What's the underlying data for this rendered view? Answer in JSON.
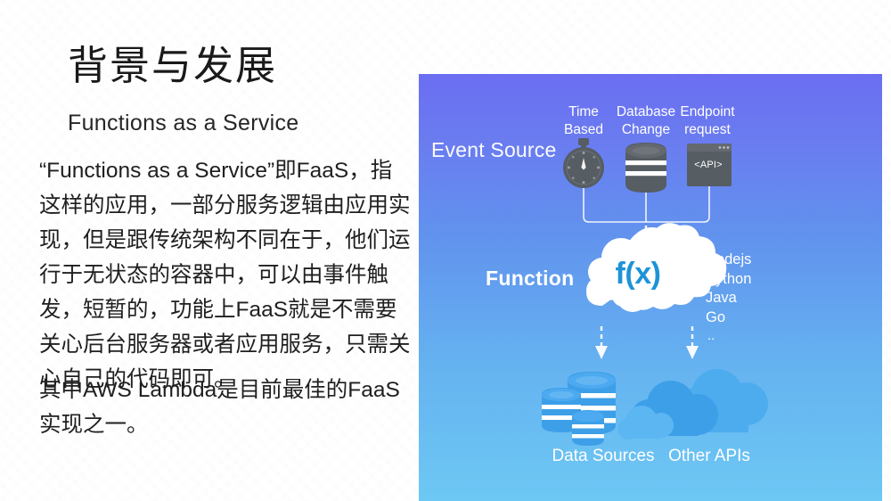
{
  "slide": {
    "title": "背景与发展",
    "subtitle": "Functions as a Service",
    "paragraph_1": "   “Functions as a Service”即FaaS，指这样的应用，一部分服务逻辑由应用实现，但是跟传统架构不同在于，他们运行于无状态的容器中，可以由事件触发，短暂的，功能上FaaS就是不需要关心后台服务器或者应用服务，只需关心自己的代码即可。",
    "paragraph_2": "其中AWS Lambda是目前最佳的FaaS实现之一。"
  },
  "diagram": {
    "event_source_label": "Event Source",
    "function_label": "Function",
    "fx_label": "f(x)",
    "api_label": "<API>",
    "sources": [
      {
        "line1": "Time",
        "line2": "Based",
        "icon": "stopwatch-icon"
      },
      {
        "line1": "Database",
        "line2": "Change",
        "icon": "database-icon"
      },
      {
        "line1": "Endpoint",
        "line2": "request",
        "icon": "api-window-icon"
      }
    ],
    "runtimes": [
      "Nodejs",
      "Python",
      "Java",
      "Go"
    ],
    "runtimes_more": "..",
    "outputs": [
      {
        "label": "Data Sources",
        "icon": "database-stack-icon"
      },
      {
        "label": "Other APIs",
        "icon": "cloud-group-icon"
      }
    ],
    "colors": {
      "gradient_top": "#6b6ef2",
      "gradient_bottom": "#6dc8f4",
      "icon_dark": "#565d63",
      "cloud_white": "#ffffff",
      "fx_blue": "#1e93d6",
      "output_blue": "#3d9fe8",
      "output_blue_light": "#56b2f0"
    }
  }
}
